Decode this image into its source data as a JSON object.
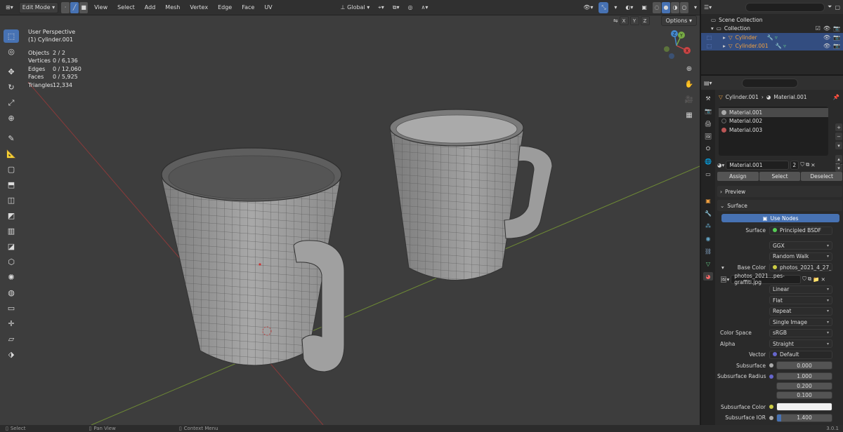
{
  "header": {
    "mode": "Edit Mode",
    "menus": [
      "View",
      "Select",
      "Add",
      "Mesh",
      "Vertex",
      "Edge",
      "Face",
      "UV"
    ],
    "orientation": "Global",
    "options_label": "Options",
    "axes": [
      "X",
      "Y",
      "Z"
    ]
  },
  "viewport": {
    "view_name": "User Perspective",
    "object_name": "(1) Cylinder.001",
    "stats": [
      {
        "label": "Objects",
        "value": "2 / 2"
      },
      {
        "label": "Vertices",
        "value": "0 / 6,136"
      },
      {
        "label": "Edges",
        "value": "0 / 12,060"
      },
      {
        "label": "Faces",
        "value": "0 / 5,925"
      },
      {
        "label": "Triangles",
        "value": "12,334"
      }
    ],
    "gizmo": {
      "x": "X",
      "y": "Y",
      "z": "Z"
    }
  },
  "outliner": {
    "scene_collection": "Scene Collection",
    "collection": "Collection",
    "objects": [
      "Cylinder",
      "Cylinder.001"
    ]
  },
  "properties": {
    "breadcrumb_object": "Cylinder.001",
    "breadcrumb_material": "Material.001",
    "slots": [
      "Material.001",
      "Material.002",
      "Material.003"
    ],
    "material_name": "Material.001",
    "users": "2",
    "assign": "Assign",
    "select": "Select",
    "deselect": "Deselect",
    "preview": "Preview",
    "surface_panel": "Surface",
    "use_nodes": "Use Nodes",
    "surface_label": "Surface",
    "surface_value": "Principled BSDF",
    "distribution": "GGX",
    "subsurface_method": "Random Walk",
    "base_color_label": "Base Color",
    "base_color_value": "photos_2021_4_27_fs...",
    "image_name": "photos_2021...pes-graffiti.jpg",
    "interpolation": "Linear",
    "projection": "Flat",
    "extension": "Repeat",
    "source": "Single Image",
    "color_space_label": "Color Space",
    "color_space": "sRGB",
    "alpha_label": "Alpha",
    "alpha": "Straight",
    "vector_label": "Vector",
    "vector": "Default",
    "subsurface_label": "Subsurface",
    "subsurface": "0.000",
    "subsurface_radius_label": "Subsurface Radius",
    "subsurface_radius": [
      "1.000",
      "0.200",
      "0.100"
    ],
    "subsurface_color_label": "Subsurface Color",
    "subsurface_ior_label": "Subsurface IOR",
    "subsurface_ior": "1.400",
    "version": "3.0.1"
  },
  "statusbar": {
    "select": "Select",
    "pan": "Pan View",
    "context": "Context Menu"
  }
}
